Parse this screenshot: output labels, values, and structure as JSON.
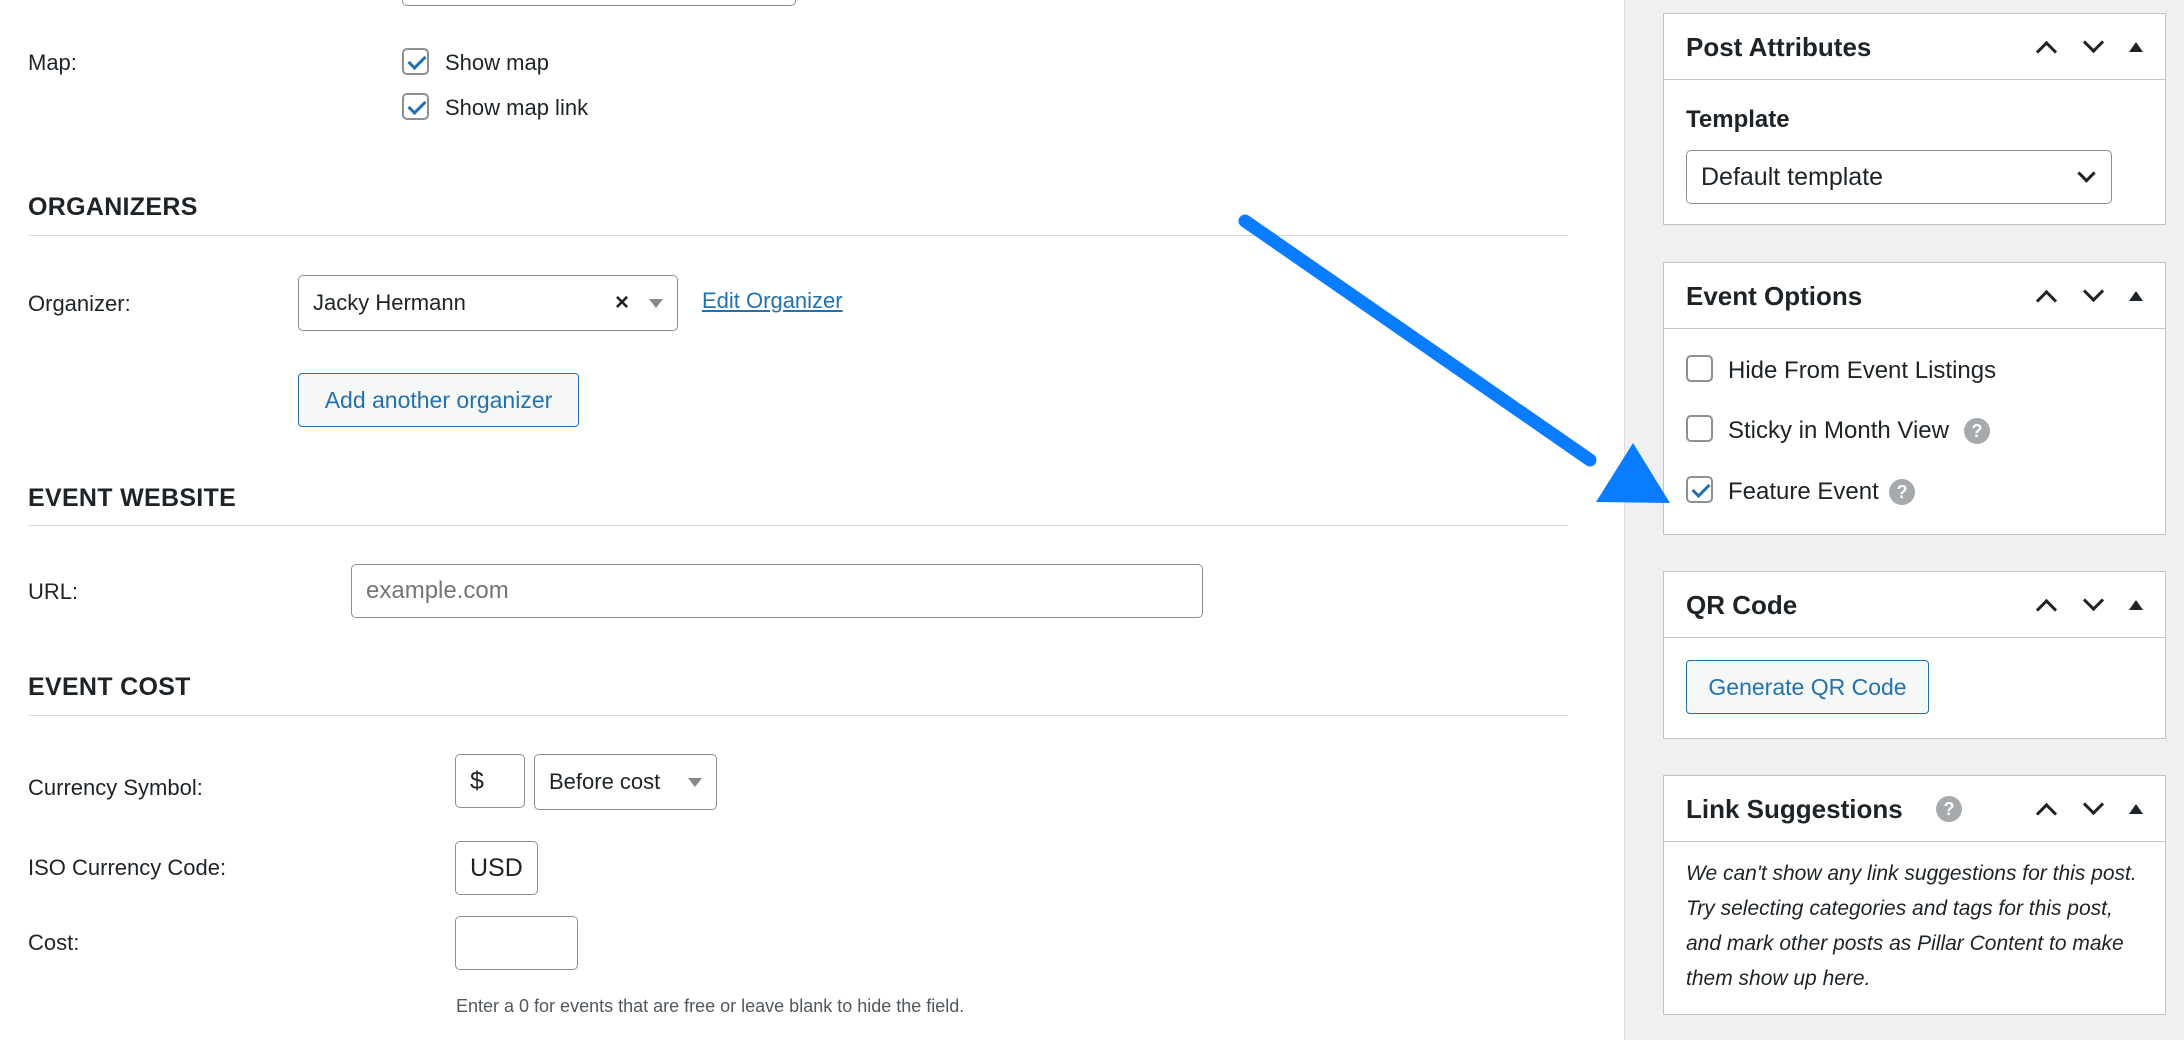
{
  "map": {
    "label": "Map:",
    "show_map": "Show map",
    "show_map_link": "Show map link"
  },
  "organizers": {
    "title": "ORGANIZERS",
    "label": "Organizer:",
    "selected": "Jacky Hermann",
    "clear_symbol": "×",
    "edit_link": "Edit Organizer",
    "add_button": "Add another organizer"
  },
  "website": {
    "title": "EVENT WEBSITE",
    "label": "URL:",
    "placeholder": "example.com"
  },
  "cost": {
    "title": "EVENT COST",
    "currency_symbol_label": "Currency Symbol:",
    "currency_symbol_value": "$",
    "currency_position": "Before cost",
    "iso_label": "ISO Currency Code:",
    "iso_value": "USD",
    "cost_label": "Cost:",
    "cost_value": "",
    "hint": "Enter a 0 for events that are free or leave blank to hide the field."
  },
  "post_attributes": {
    "title": "Post Attributes",
    "template_label": "Template",
    "template_value": "Default template"
  },
  "event_options": {
    "title": "Event Options",
    "hide_label": "Hide From Event Listings",
    "sticky_label": "Sticky in Month View",
    "feature_label": "Feature Event",
    "hide_checked": false,
    "sticky_checked": false,
    "feature_checked": true
  },
  "qr_code": {
    "title": "QR Code",
    "button": "Generate QR Code"
  },
  "link_suggestions": {
    "title": "Link Suggestions",
    "text": "We can't show any link suggestions for this post. Try selecting categories and tags for this post, and mark other posts as Pillar Content to make them show up here."
  },
  "help_glyph": "?",
  "colors": {
    "accent": "#2271b1",
    "arrow": "#0a7cff"
  }
}
